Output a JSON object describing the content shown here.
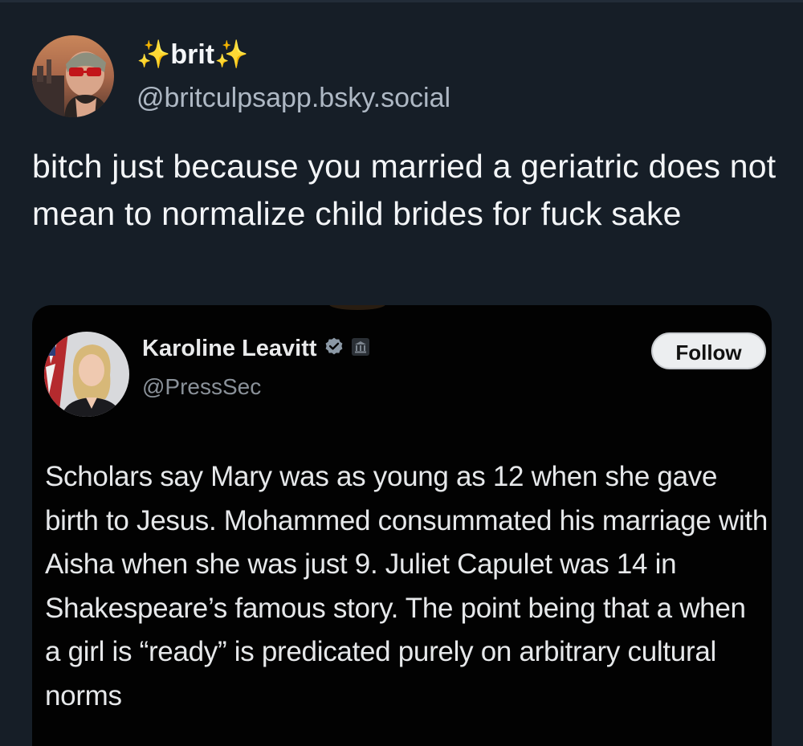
{
  "post": {
    "author": {
      "display_name": "✨brit✨",
      "handle": "@britculpsapp.bsky.social"
    },
    "text": "bitch just because you married a geriatric does not mean to normalize child brides for fuck sake"
  },
  "embed": {
    "author": {
      "display_name": "Karoline Leavitt",
      "handle": "@PressSec"
    },
    "follow_label": "Follow",
    "text": "Scholars say Mary was as young as 12 when she gave birth to Jesus. Mohammed consummated his marriage with Aisha when she was just 9. Juliet Capulet was 14 in Shakespeare’s famous story. The point being that a when a girl is “ready” is predicated purely on arbitrary cultural norms"
  },
  "icons": {
    "verified": "verified-badge-icon",
    "affiliation": "government-affiliation-icon"
  },
  "colors": {
    "background": "#161e27",
    "embed_background": "#020202",
    "handle": "#aeb8c4",
    "verified": "#8b98a5"
  }
}
